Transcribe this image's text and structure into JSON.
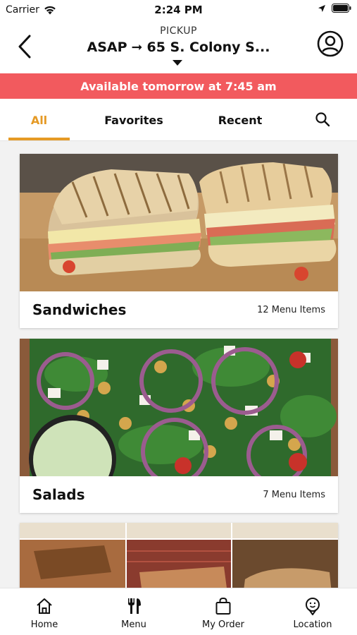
{
  "status_bar": {
    "carrier": "Carrier",
    "time": "2:24 PM"
  },
  "header": {
    "mode_label": "PICKUP",
    "route_from": "ASAP",
    "route_arrow": "➞",
    "route_to": "65 S. Colony S..."
  },
  "banner": {
    "text": "Available tomorrow at 7:45 am",
    "color": "#f25a5e"
  },
  "tabs": [
    {
      "label": "All",
      "active": true
    },
    {
      "label": "Favorites",
      "active": false
    },
    {
      "label": "Recent",
      "active": false
    }
  ],
  "accent_color": "#e59a25",
  "categories": [
    {
      "title": "Sandwiches",
      "count_label": "12 Menu Items",
      "image_icon": "sandwich-photo"
    },
    {
      "title": "Salads",
      "count_label": "7 Menu Items",
      "image_icon": "salad-photo"
    }
  ],
  "bottom_nav": [
    {
      "label": "Home",
      "icon": "home-icon"
    },
    {
      "label": "Menu",
      "icon": "utensils-icon"
    },
    {
      "label": "My Order",
      "icon": "bag-icon"
    },
    {
      "label": "Location",
      "icon": "location-icon"
    }
  ]
}
